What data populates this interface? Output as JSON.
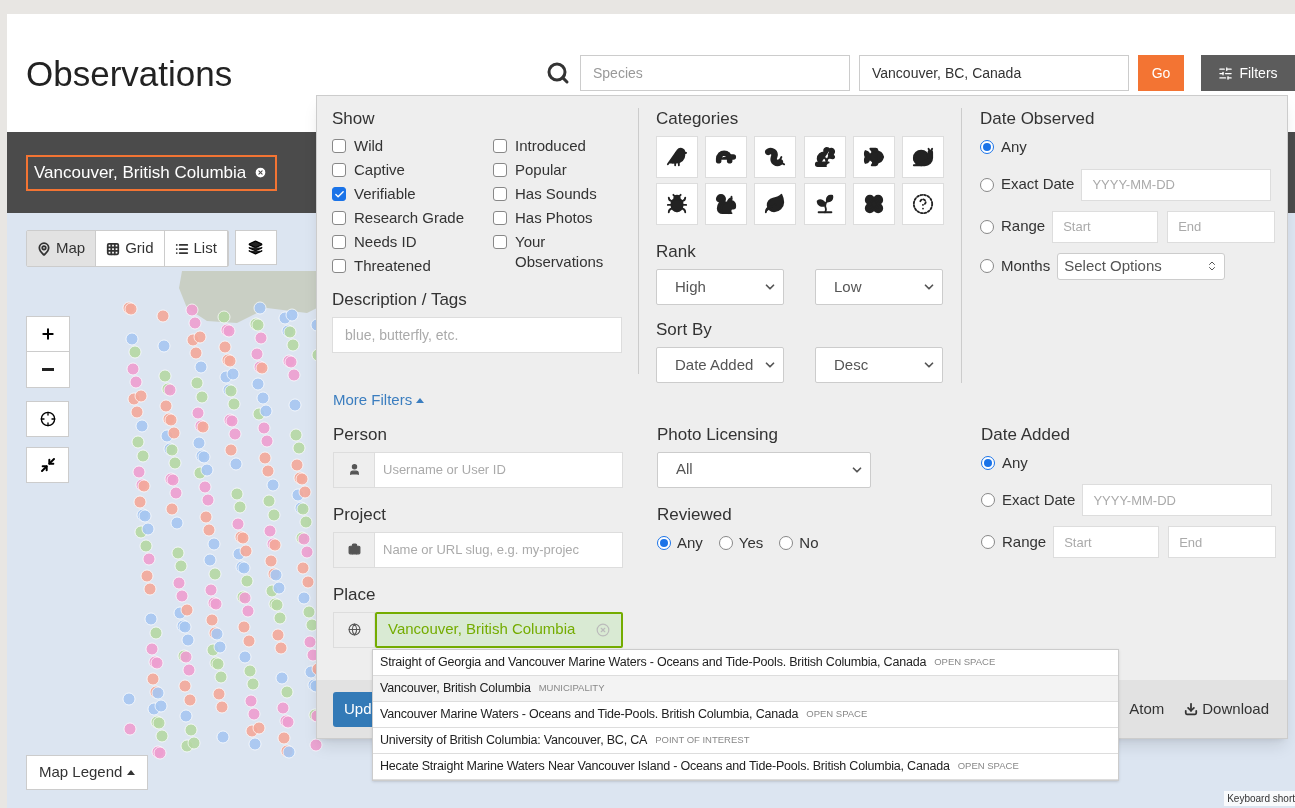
{
  "page": {
    "title": "Observations"
  },
  "search": {
    "species_placeholder": "Species",
    "location_value": "Vancouver, BC, Canada",
    "go": "Go",
    "filters": "Filters"
  },
  "place_pill": {
    "label": "Vancouver, British Columbia"
  },
  "map": {
    "views": [
      {
        "label": "Map",
        "kind": "map",
        "selected": true
      },
      {
        "label": "Grid",
        "kind": "grid",
        "selected": false
      },
      {
        "label": "List",
        "kind": "list",
        "selected": false
      }
    ],
    "legend": "Map Legend",
    "attribution": "Keyboard short"
  },
  "filters": {
    "show": {
      "title": "Show",
      "left": [
        {
          "label": "Wild",
          "checked": false
        },
        {
          "label": "Captive",
          "checked": false
        },
        {
          "label": "Verifiable",
          "checked": true
        },
        {
          "label": "Research Grade",
          "checked": false
        },
        {
          "label": "Needs ID",
          "checked": false
        },
        {
          "label": "Threatened",
          "checked": false
        }
      ],
      "right": [
        {
          "label": "Introduced",
          "checked": false
        },
        {
          "label": "Popular",
          "checked": false
        },
        {
          "label": "Has Sounds",
          "checked": false
        },
        {
          "label": "Has Photos",
          "checked": false
        },
        {
          "label": "Your Observations",
          "checked": false
        }
      ]
    },
    "description": {
      "title": "Description / Tags",
      "placeholder": "blue, butterfly, etc."
    },
    "categories": {
      "title": "Categories",
      "items": [
        {
          "kind": "bird",
          "selected": false
        },
        {
          "kind": "amphibian",
          "selected": false
        },
        {
          "kind": "reptile",
          "selected": false
        },
        {
          "kind": "mammal",
          "selected": false
        },
        {
          "kind": "fish",
          "selected": false
        },
        {
          "kind": "mollusk",
          "selected": false
        },
        {
          "kind": "arachnid",
          "selected": false
        },
        {
          "kind": "insect",
          "selected": false
        },
        {
          "kind": "plant",
          "selected": false
        },
        {
          "kind": "fungi",
          "selected": false
        },
        {
          "kind": "protozoa",
          "selected": false
        },
        {
          "kind": "unknown",
          "selected": false
        }
      ]
    },
    "rank": {
      "title": "Rank",
      "high": "High",
      "low": "Low"
    },
    "sort": {
      "title": "Sort By",
      "field": "Date Added",
      "order": "Desc"
    },
    "date_observed": {
      "title": "Date Observed",
      "options": [
        {
          "kind": "any",
          "label": "Any",
          "selected": true
        },
        {
          "kind": "exact",
          "label": "Exact Date",
          "placeholder": "YYYY-MM-DD",
          "selected": false
        },
        {
          "kind": "range",
          "label": "Range",
          "start_placeholder": "Start",
          "end_placeholder": "End",
          "selected": false
        },
        {
          "kind": "months",
          "label": "Months",
          "select": "Select Options",
          "selected": false
        }
      ]
    },
    "more_filters": {
      "label": "More Filters",
      "expanded": true
    },
    "person": {
      "title": "Person",
      "placeholder": "Username or User ID"
    },
    "project": {
      "title": "Project",
      "placeholder": "Name or URL slug, e.g. my-projec"
    },
    "place": {
      "title": "Place",
      "value": "Vancouver, British Columbia"
    },
    "photo_licensing": {
      "title": "Photo Licensing",
      "value": "All"
    },
    "reviewed": {
      "title": "Reviewed",
      "options": [
        {
          "label": "Any",
          "selected": true
        },
        {
          "label": "Yes",
          "selected": false
        },
        {
          "label": "No",
          "selected": false
        }
      ]
    },
    "date_added": {
      "title": "Date Added",
      "options": [
        {
          "kind": "any",
          "label": "Any",
          "selected": true
        },
        {
          "kind": "exact",
          "label": "Exact Date",
          "placeholder": "YYYY-MM-DD",
          "selected": false
        },
        {
          "kind": "range",
          "label": "Range",
          "start_placeholder": "Start",
          "end_placeholder": "End",
          "selected": false
        }
      ]
    },
    "footer": {
      "update": "Upd",
      "atom": "Atom",
      "download": "Download"
    }
  },
  "suggestions": [
    {
      "label": "Straight of Georgia and Vancouver Marine Waters - Oceans and Tide-Pools. British Columbia, Canada",
      "type": "OPEN SPACE",
      "selected": false
    },
    {
      "label": "Vancouver, British Columbia",
      "type": "MUNICIPALITY",
      "selected": true
    },
    {
      "label": "Vancouver Marine Waters - Oceans and Tide-Pools. British Columbia, Canada",
      "type": "OPEN SPACE",
      "selected": false
    },
    {
      "label": "University of British Columbia: Vancouver, BC, CA",
      "type": "POINT OF INTEREST",
      "selected": false
    },
    {
      "label": "Hecate Straight Marine Waters Near Vancouver Island - Oceans and Tide-Pools. British Columbia, Canada",
      "type": "OPEN SPACE",
      "selected": false
    }
  ]
}
